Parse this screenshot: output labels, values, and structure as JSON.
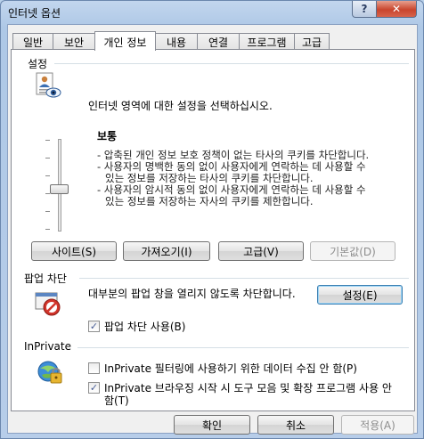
{
  "window": {
    "title": "인터넷 옵션"
  },
  "titlebar": {
    "help_glyph": "?",
    "close_glyph": "✕"
  },
  "tabs": [
    {
      "label": "일반"
    },
    {
      "label": "보안"
    },
    {
      "label": "개인 정보",
      "active": true
    },
    {
      "label": "내용"
    },
    {
      "label": "연결"
    },
    {
      "label": "프로그램"
    },
    {
      "label": "고급"
    }
  ],
  "settings": {
    "heading": "설정",
    "instruction": "인터넷 영역에 대한 설정을 선택하십시오.",
    "level_name": "보통",
    "slider_level": "보통",
    "description_lines": [
      "- 압축된 개인 정보 보호 정책이 없는 타사의 쿠키를 차단합니다.",
      "- 사용자의 명백한 동의 없이 사용자에게 연락하는 데 사용할 수",
      "있는 정보를 저장하는 타사의 쿠키를 차단합니다.",
      "- 사용자의 암시적 동의 없이 사용자에게 연락하는 데 사용할 수",
      "있는 정보를 저장하는 자사의 쿠키를 제한합니다."
    ],
    "buttons": {
      "sites": "사이트(S)",
      "import": "가져오기(I)",
      "advanced": "고급(V)",
      "default": "기본값(D)"
    }
  },
  "popup": {
    "heading": "팝업 차단",
    "description": "대부분의 팝업 창을 열리지 않도록 차단합니다.",
    "settings_button": "설정(E)",
    "enable_label": "팝업 차단 사용(B)",
    "enable_checked": true
  },
  "inprivate": {
    "heading": "InPrivate",
    "filtering_label": "InPrivate 필터링에 사용하기 위한 데이터 수집 안 함(P)",
    "filtering_checked": false,
    "browsing_label_line1": "InPrivate 브라우징 시작 시 도구 모음 및 확장 프로그램 사용 안",
    "browsing_label_line2": "함(T)",
    "browsing_checked": true
  },
  "footer": {
    "ok": "확인",
    "cancel": "취소",
    "apply": "적용(A)"
  }
}
